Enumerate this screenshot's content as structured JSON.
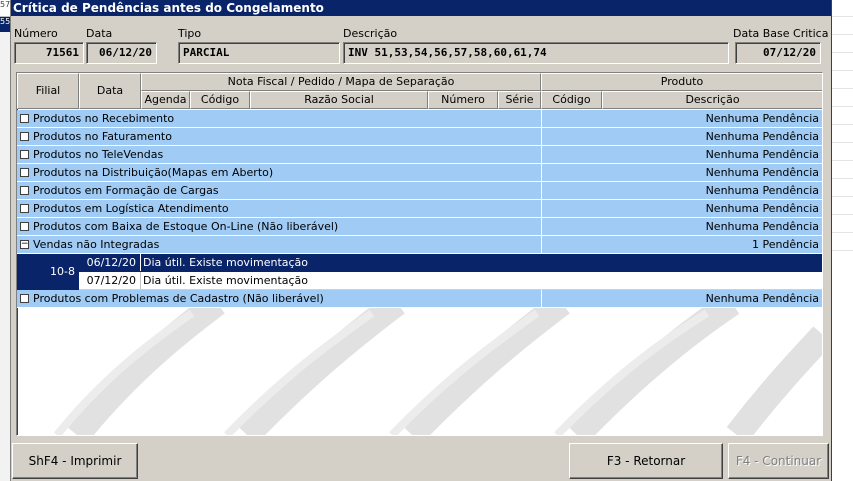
{
  "window": {
    "title": "Crítica de Pendências antes do Congelamento"
  },
  "background": {
    "left_text_top": "57",
    "left_text_bottom": "55"
  },
  "fields": {
    "numero": {
      "label": "Número",
      "value": "71561"
    },
    "data": {
      "label": "Data",
      "value": "06/12/20"
    },
    "tipo": {
      "label": "Tipo",
      "value": "PARCIAL"
    },
    "descricao": {
      "label": "Descrição",
      "value": "INV 51,53,54,56,57,58,60,61,74"
    },
    "data_base": {
      "label": "Data Base Critica",
      "value": "07/12/20"
    }
  },
  "grid": {
    "headers": {
      "filial": "Filial",
      "data": "Data",
      "nota_group": "Nota Fiscal / Pedido / Mapa de Separação",
      "agenda": "Agenda",
      "codigo": "Código",
      "razao_social": "Razão Social",
      "numero": "Número",
      "serie": "Série",
      "produto_group": "Produto",
      "prod_codigo": "Código",
      "prod_descricao": "Descrição"
    },
    "rows": [
      {
        "label": "Produtos no Recebimento",
        "status": "Nenhuma Pendência",
        "expander": ""
      },
      {
        "label": "Produtos no Faturamento",
        "status": "Nenhuma Pendência",
        "expander": ""
      },
      {
        "label": "Produtos no TeleVendas",
        "status": "Nenhuma Pendência",
        "expander": ""
      },
      {
        "label": "Produtos na Distribuição(Mapas em Aberto)",
        "status": "Nenhuma Pendência",
        "expander": ""
      },
      {
        "label": "Produtos em Formação de Cargas",
        "status": "Nenhuma Pendência",
        "expander": ""
      },
      {
        "label": "Produtos em Logística Atendimento",
        "status": "Nenhuma Pendência",
        "expander": ""
      },
      {
        "label": "Produtos com Baixa de Estoque On-Line (Não liberável)",
        "status": "Nenhuma Pendência",
        "expander": ""
      },
      {
        "label": "Vendas não Integradas",
        "status": "1 Pendência",
        "expander": "−"
      }
    ],
    "subrows": {
      "filial": "10-8",
      "items": [
        {
          "data": "06/12/20",
          "text": "Dia útil. Existe movimentação"
        },
        {
          "data": "07/12/20",
          "text": "Dia útil. Existe movimentação"
        }
      ]
    },
    "last_row": {
      "label": "Produtos com Problemas de Cadastro (Não liberável)",
      "status": "Nenhuma Pendência",
      "expander": ""
    }
  },
  "buttons": {
    "imprimir": "ShF4 - Imprimir",
    "retornar": "F3 - Retornar",
    "continuar": "F4 - Continuar"
  },
  "colors": {
    "titlebar": "#0a246a",
    "row_blue": "#9fcbf5",
    "selected_row": "#0a246a"
  }
}
